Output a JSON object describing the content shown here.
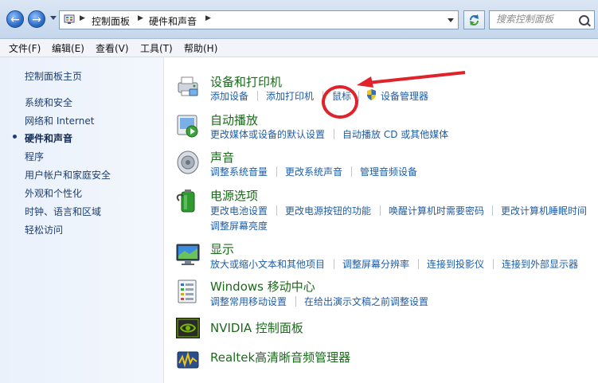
{
  "address_bar": {
    "breadcrumb": [
      "控制面板",
      "硬件和声音"
    ],
    "search_placeholder": "搜索控制面板"
  },
  "menu": [
    "文件(F)",
    "编辑(E)",
    "查看(V)",
    "工具(T)",
    "帮助(H)"
  ],
  "sidebar": {
    "home": "控制面板主页",
    "items": [
      {
        "label": "系统和安全",
        "current": false
      },
      {
        "label": "网络和 Internet",
        "current": false
      },
      {
        "label": "硬件和声音",
        "current": true
      },
      {
        "label": "程序",
        "current": false
      },
      {
        "label": "用户帐户和家庭安全",
        "current": false
      },
      {
        "label": "外观和个性化",
        "current": false
      },
      {
        "label": "时钟、语言和区域",
        "current": false
      },
      {
        "label": "轻松访问",
        "current": false
      }
    ]
  },
  "categories": [
    {
      "title": "设备和打印机",
      "icon": "printer-icon",
      "links": [
        "添加设备",
        "添加打印机",
        "鼠标",
        "设备管理器"
      ]
    },
    {
      "title": "自动播放",
      "icon": "autoplay-icon",
      "links": [
        "更改媒体或设备的默认设置",
        "自动播放 CD 或其他媒体"
      ]
    },
    {
      "title": "声音",
      "icon": "speaker-icon",
      "links": [
        "调整系统音量",
        "更改系统声音",
        "管理音频设备"
      ]
    },
    {
      "title": "电源选项",
      "icon": "battery-icon",
      "links": [
        "更改电池设置",
        "更改电源按钮的功能",
        "唤醒计算机时需要密码",
        "更改计算机睡眠时间",
        "调整屏幕亮度"
      ]
    },
    {
      "title": "显示",
      "icon": "monitor-icon",
      "links": [
        "放大或缩小文本和其他项目",
        "调整屏幕分辨率",
        "连接到投影仪",
        "连接到外部显示器"
      ]
    },
    {
      "title": "Windows 移动中心",
      "icon": "mobility-center-icon",
      "links": [
        "调整常用移动设置",
        "在给出演示文稿之前调整设置"
      ]
    },
    {
      "title": "NVIDIA 控制面板",
      "icon": "nvidia-icon",
      "links": []
    },
    {
      "title": "Realtek高清晰音频管理器",
      "icon": "realtek-audio-icon",
      "links": []
    }
  ],
  "colors": {
    "link": "#1e5ca7",
    "title": "#1a6a1a",
    "annotation": "#e0222a"
  }
}
